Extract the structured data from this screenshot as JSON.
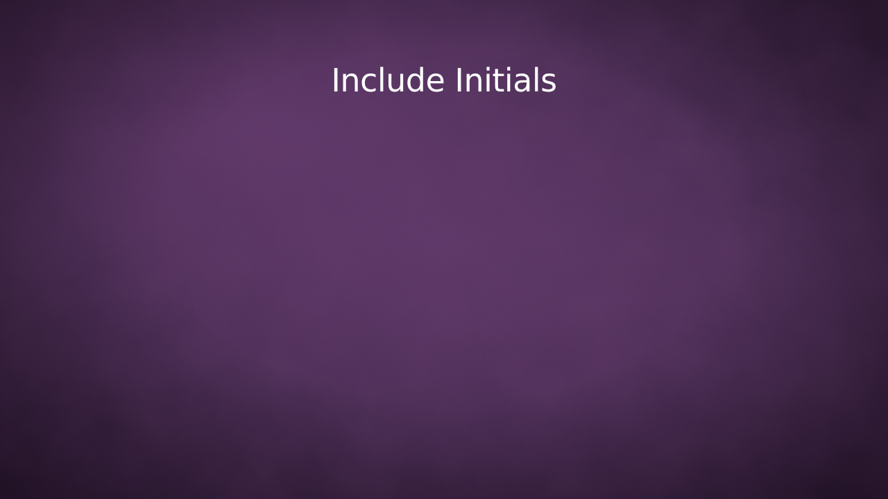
{
  "slide": {
    "title": "Include Initials"
  },
  "colors": {
    "background": "#3a2040",
    "title_text": "#ffffff"
  }
}
